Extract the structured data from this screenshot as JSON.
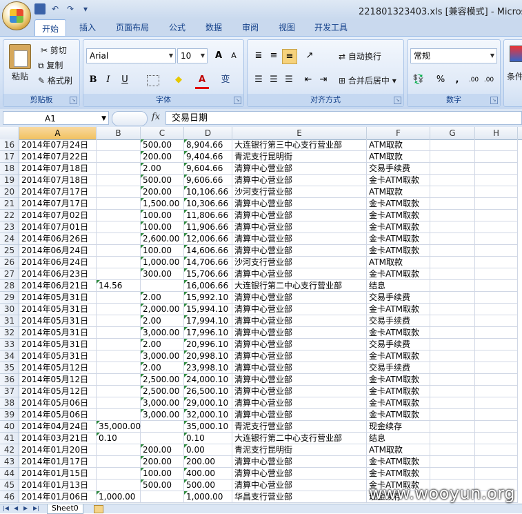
{
  "window": {
    "title": "221801323403.xls  [兼容模式] - Microsoft"
  },
  "ribbon": {
    "tabs": [
      "开始",
      "插入",
      "页面布局",
      "公式",
      "数据",
      "审阅",
      "视图",
      "开发工具"
    ],
    "clipboard": {
      "paste": "粘贴",
      "cut": "剪切",
      "copy": "复制",
      "format_painter": "格式刷",
      "group_title": "剪贴板"
    },
    "font": {
      "name": "Arial",
      "size": "10",
      "grow": "A",
      "shrink": "A",
      "bold": "B",
      "italic": "I",
      "underline": "U",
      "font_color": "A",
      "phonetic": "变",
      "group_title": "字体"
    },
    "alignment": {
      "wrap": "自动换行",
      "merge": "合并后居中",
      "group_title": "对齐方式"
    },
    "number": {
      "format": "常规",
      "percent": "%",
      "comma": ",",
      "inc": ".00",
      "dec": ".00",
      "group_title": "数字"
    },
    "styles": {
      "conditional": "条件"
    }
  },
  "formula_bar": {
    "name_box": "A1",
    "fx": "fx",
    "content": "交易日期"
  },
  "columns": [
    "A",
    "B",
    "C",
    "D",
    "E",
    "F",
    "G",
    "H"
  ],
  "rows": [
    {
      "n": "16",
      "a": "2014年07月24日",
      "b": "",
      "c": "500.00",
      "d": "8,904.66",
      "e": "大连银行第三中心支行营业部",
      "f": "ATM取款"
    },
    {
      "n": "17",
      "a": "2014年07月22日",
      "b": "",
      "c": "200.00",
      "d": "9,404.66",
      "e": "青泥支行昆明街",
      "f": "ATM取款"
    },
    {
      "n": "18",
      "a": "2014年07月18日",
      "b": "",
      "c": "2.00",
      "d": "9,604.66",
      "e": "清算中心营业部",
      "f": "交易手续费"
    },
    {
      "n": "19",
      "a": "2014年07月18日",
      "b": "",
      "c": "500.00",
      "d": "9,606.66",
      "e": "清算中心营业部",
      "f": "金卡ATM取款"
    },
    {
      "n": "20",
      "a": "2014年07月17日",
      "b": "",
      "c": "200.00",
      "d": "10,106.66",
      "e": "沙河支行营业部",
      "f": "ATM取款"
    },
    {
      "n": "21",
      "a": "2014年07月17日",
      "b": "",
      "c": "1,500.00",
      "d": "10,306.66",
      "e": "清算中心营业部",
      "f": "金卡ATM取款"
    },
    {
      "n": "22",
      "a": "2014年07月02日",
      "b": "",
      "c": "100.00",
      "d": "11,806.66",
      "e": "清算中心营业部",
      "f": "金卡ATM取款"
    },
    {
      "n": "23",
      "a": "2014年07月01日",
      "b": "",
      "c": "100.00",
      "d": "11,906.66",
      "e": "清算中心营业部",
      "f": "金卡ATM取款"
    },
    {
      "n": "24",
      "a": "2014年06月26日",
      "b": "",
      "c": "2,600.00",
      "d": "12,006.66",
      "e": "清算中心营业部",
      "f": "金卡ATM取款"
    },
    {
      "n": "25",
      "a": "2014年06月24日",
      "b": "",
      "c": "100.00",
      "d": "14,606.66",
      "e": "清算中心营业部",
      "f": "金卡ATM取款"
    },
    {
      "n": "26",
      "a": "2014年06月24日",
      "b": "",
      "c": "1,000.00",
      "d": "14,706.66",
      "e": "沙河支行营业部",
      "f": "ATM取款"
    },
    {
      "n": "27",
      "a": "2014年06月23日",
      "b": "",
      "c": "300.00",
      "d": "15,706.66",
      "e": "清算中心营业部",
      "f": "金卡ATM取款"
    },
    {
      "n": "28",
      "a": "2014年06月21日",
      "b": "14.56",
      "c": "",
      "d": "16,006.66",
      "e": "大连银行第二中心支行营业部",
      "f": "结息"
    },
    {
      "n": "29",
      "a": "2014年05月31日",
      "b": "",
      "c": "2.00",
      "d": "15,992.10",
      "e": "清算中心营业部",
      "f": "交易手续费"
    },
    {
      "n": "30",
      "a": "2014年05月31日",
      "b": "",
      "c": "2,000.00",
      "d": "15,994.10",
      "e": "清算中心营业部",
      "f": "金卡ATM取款"
    },
    {
      "n": "31",
      "a": "2014年05月31日",
      "b": "",
      "c": "2.00",
      "d": "17,994.10",
      "e": "清算中心营业部",
      "f": "交易手续费"
    },
    {
      "n": "32",
      "a": "2014年05月31日",
      "b": "",
      "c": "3,000.00",
      "d": "17,996.10",
      "e": "清算中心营业部",
      "f": "金卡ATM取款"
    },
    {
      "n": "33",
      "a": "2014年05月31日",
      "b": "",
      "c": "2.00",
      "d": "20,996.10",
      "e": "清算中心营业部",
      "f": "交易手续费"
    },
    {
      "n": "34",
      "a": "2014年05月31日",
      "b": "",
      "c": "3,000.00",
      "d": "20,998.10",
      "e": "清算中心营业部",
      "f": "金卡ATM取款"
    },
    {
      "n": "35",
      "a": "2014年05月12日",
      "b": "",
      "c": "2.00",
      "d": "23,998.10",
      "e": "清算中心营业部",
      "f": "交易手续费"
    },
    {
      "n": "36",
      "a": "2014年05月12日",
      "b": "",
      "c": "2,500.00",
      "d": "24,000.10",
      "e": "清算中心营业部",
      "f": "金卡ATM取款"
    },
    {
      "n": "37",
      "a": "2014年05月12日",
      "b": "",
      "c": "2,500.00",
      "d": "26,500.10",
      "e": "清算中心营业部",
      "f": "金卡ATM取款"
    },
    {
      "n": "38",
      "a": "2014年05月06日",
      "b": "",
      "c": "3,000.00",
      "d": "29,000.10",
      "e": "清算中心营业部",
      "f": "金卡ATM取款"
    },
    {
      "n": "39",
      "a": "2014年05月06日",
      "b": "",
      "c": "3,000.00",
      "d": "32,000.10",
      "e": "清算中心营业部",
      "f": "金卡ATM取款"
    },
    {
      "n": "40",
      "a": "2014年04月24日",
      "b": "35,000.00",
      "c": "",
      "d": "35,000.10",
      "e": "青泥支行营业部",
      "f": "现金续存"
    },
    {
      "n": "41",
      "a": "2014年03月21日",
      "b": "0.10",
      "c": "",
      "d": "0.10",
      "e": "大连银行第二中心支行营业部",
      "f": "结息"
    },
    {
      "n": "42",
      "a": "2014年01月20日",
      "b": "",
      "c": "200.00",
      "d": "0.00",
      "e": "青泥支行昆明街",
      "f": "ATM取款"
    },
    {
      "n": "43",
      "a": "2014年01月17日",
      "b": "",
      "c": "200.00",
      "d": "200.00",
      "e": "清算中心营业部",
      "f": "金卡ATM取款"
    },
    {
      "n": "44",
      "a": "2014年01月15日",
      "b": "",
      "c": "100.00",
      "d": "400.00",
      "e": "清算中心营业部",
      "f": "金卡ATM取款"
    },
    {
      "n": "45",
      "a": "2014年01月13日",
      "b": "",
      "c": "500.00",
      "d": "500.00",
      "e": "清算中心营业部",
      "f": "金卡ATM取款"
    },
    {
      "n": "46",
      "a": "2014年01月06日",
      "b": "1,000.00",
      "c": "",
      "d": "1,000.00",
      "e": "华昌支行营业部",
      "f": "现金续存"
    }
  ],
  "sheet_tabs": [
    "Sheet0"
  ],
  "watermark": "www.wooyun.org"
}
